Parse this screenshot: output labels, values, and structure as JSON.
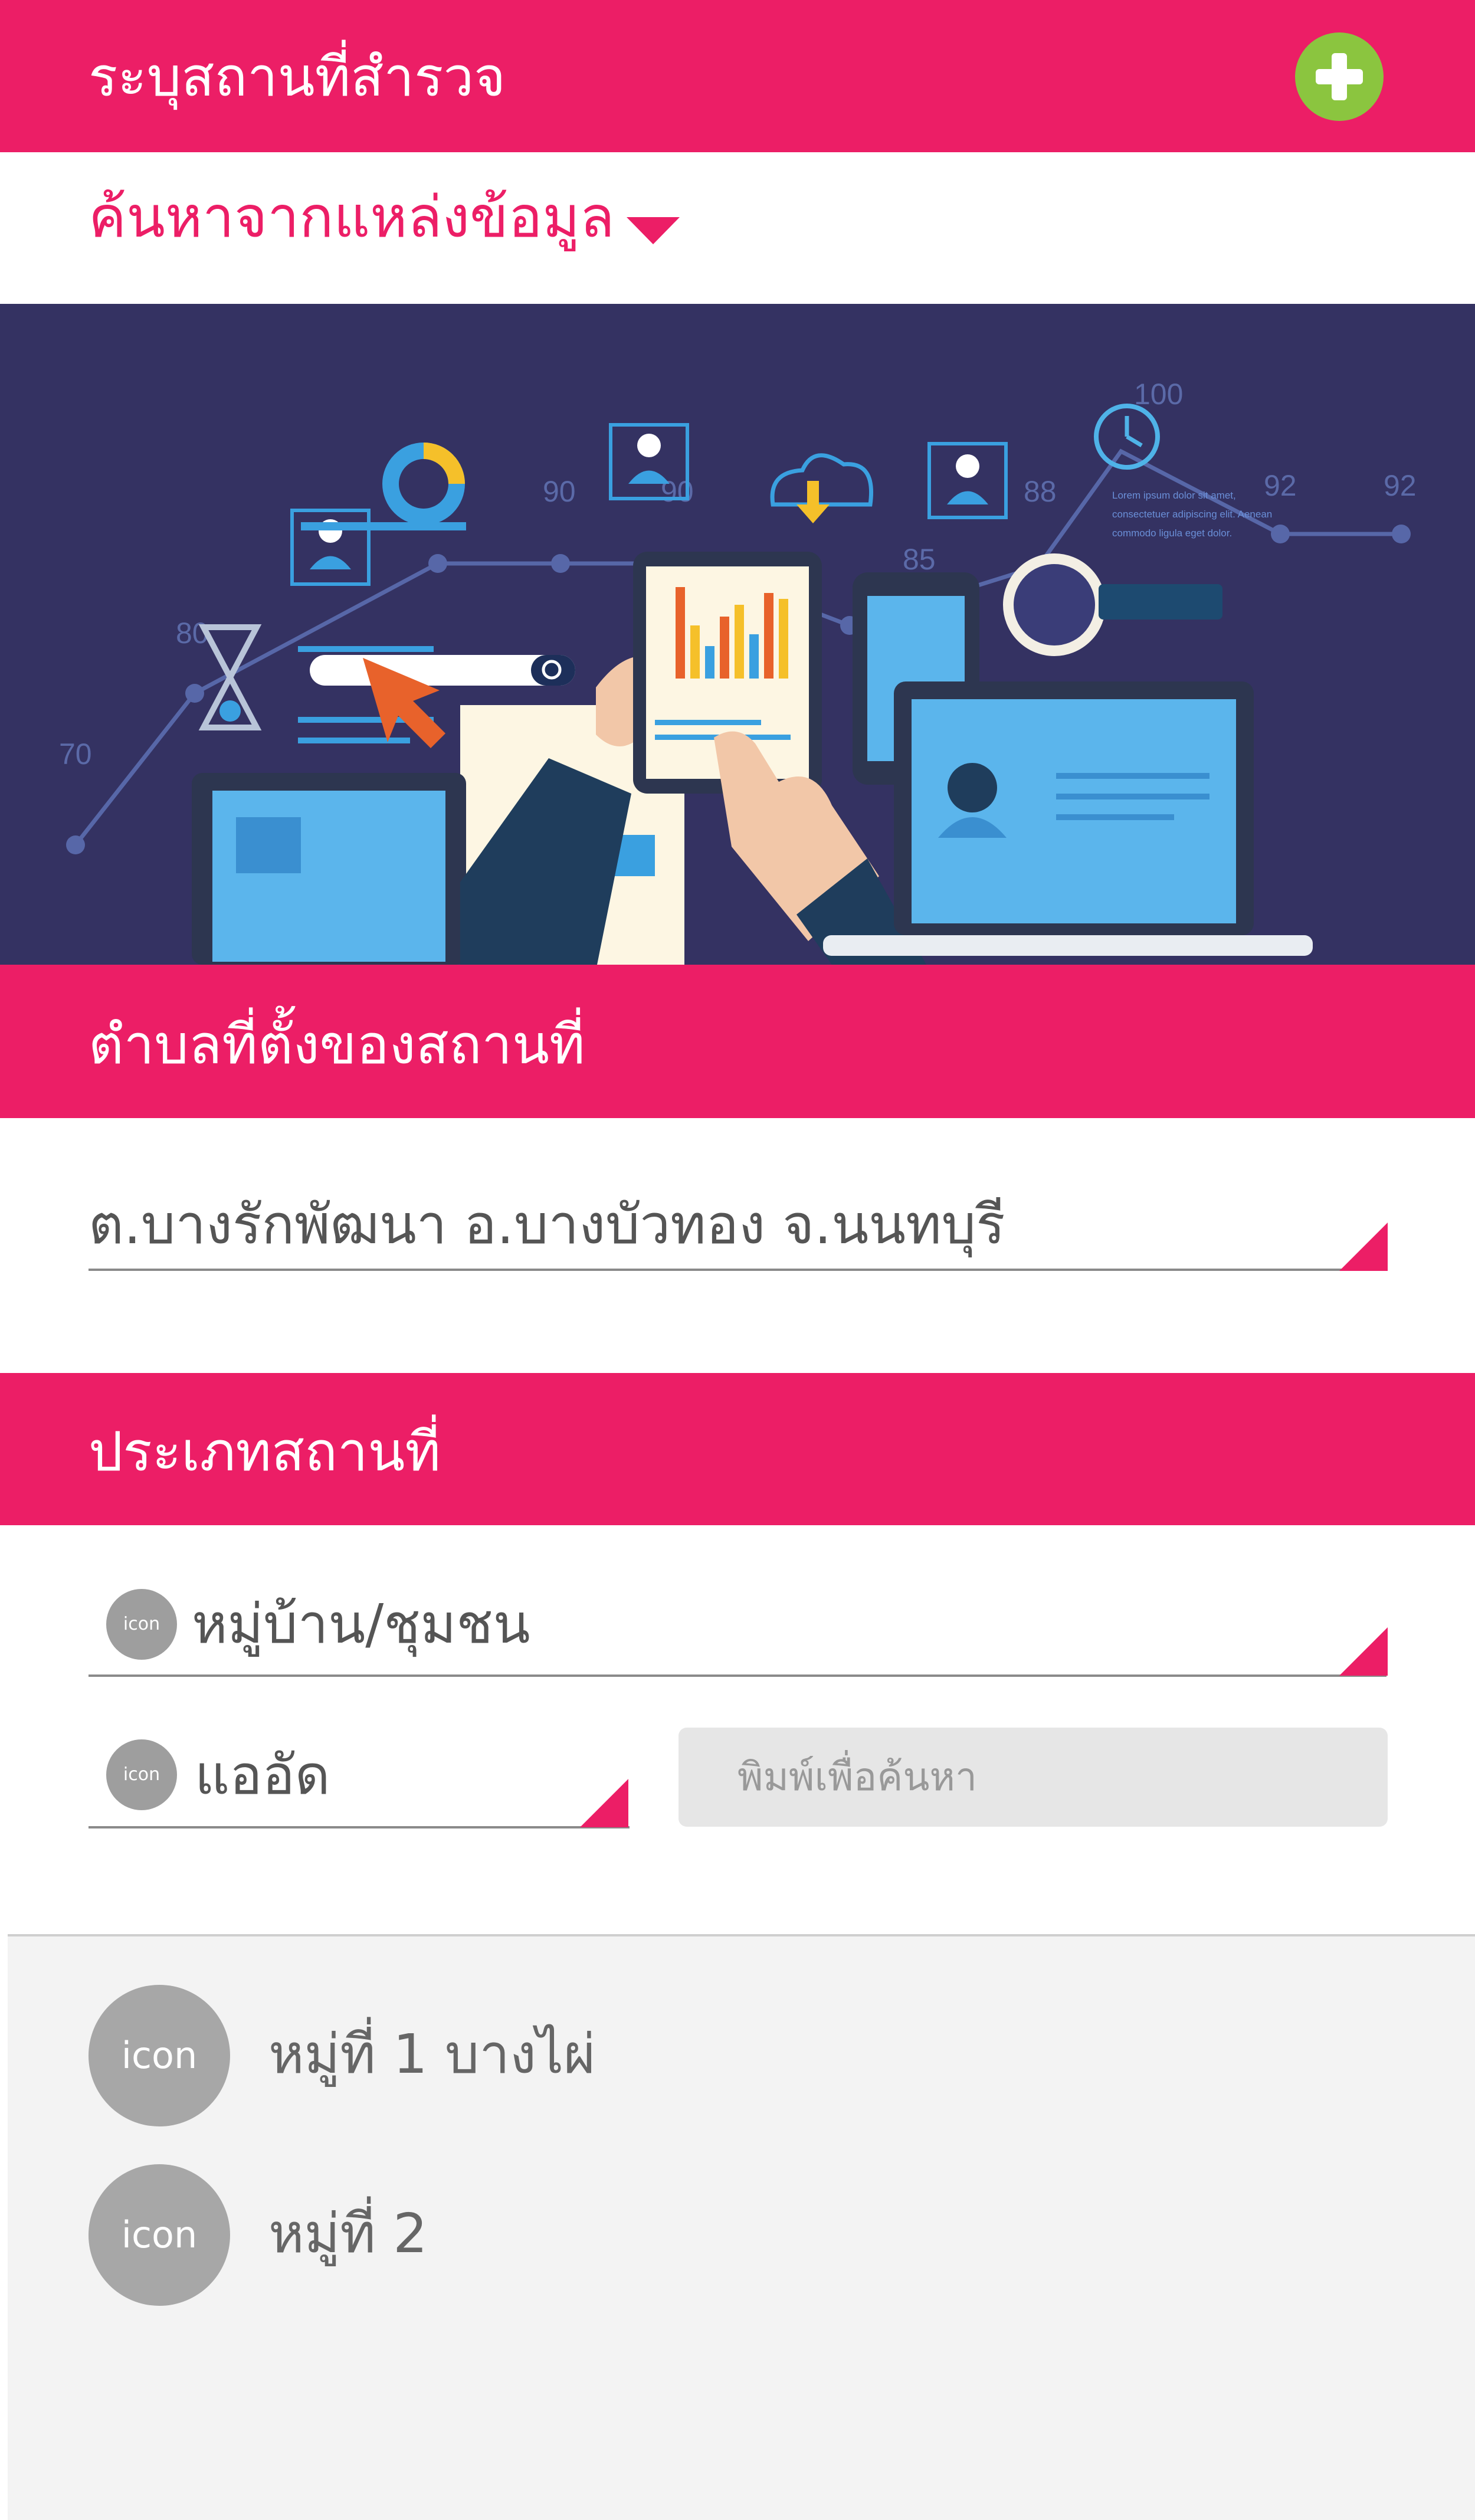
{
  "header": {
    "title": "ระบุสถานที่สำรวจ",
    "add_icon": "plus-icon",
    "add_color": "#8BC53F"
  },
  "source_select": {
    "label": "ค้นหาจากแหล่งข้อมูล",
    "icon": "caret-down-icon"
  },
  "hero": {
    "numbers": [
      "100",
      "90",
      "90",
      "88",
      "85",
      "80",
      "70",
      "92",
      "92"
    ],
    "lorem": [
      "Lorem ipsum dolor sit amet,",
      "consectetuer adipiscing elit. Aenean",
      "commodo ligula eget dolor."
    ]
  },
  "location_section": {
    "title": "ตำบลที่ตั้งของสถานที่",
    "value": "ต.บางรักพัฒนา อ.บางบัวทอง จ.นนทบุรี"
  },
  "type_section": {
    "title": "ประเภทสถานที่",
    "category": {
      "icon_text": "icon",
      "value": "หมู่บ้าน/ชุมชน"
    },
    "subcategory": {
      "icon_text": "icon",
      "value": "แออัด"
    },
    "search": {
      "placeholder": "พิมพ์เพื่อค้นหา"
    }
  },
  "results": [
    {
      "icon_text": "icon",
      "label": "หมู่ที่ 1 บางไผ่"
    },
    {
      "icon_text": "icon",
      "label": "หมู่ที่ 2"
    }
  ],
  "colors": {
    "accent": "#EC1E66",
    "hero_bg": "#343262"
  }
}
